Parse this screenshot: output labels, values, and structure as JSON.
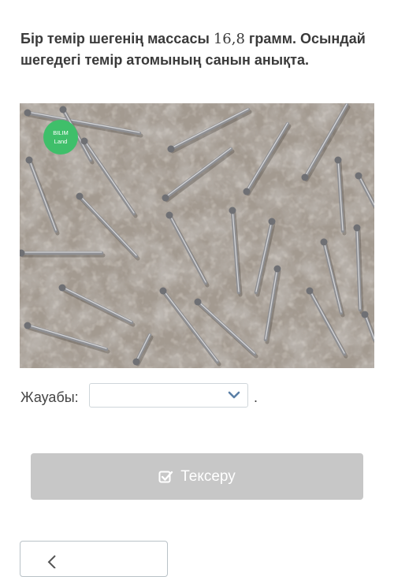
{
  "question": {
    "text_before": "Бір темір шегенің массасы ",
    "mass_value": "16,8",
    "text_after": " грамм. Осындай шегедегі темір атомының санын анықта."
  },
  "image": {
    "logo_line1": "BILIM",
    "logo_line2": "Land",
    "logo_color": "#3fbf6a"
  },
  "answer": {
    "label": "Жауабы:",
    "selected_value": "",
    "trailing": "."
  },
  "check_button": {
    "label": "Тексеру",
    "icon": "checkbox-check-icon"
  },
  "back_button": {
    "icon": "arrow-left-icon"
  },
  "colors": {
    "button_disabled": "#c7c7c7",
    "chevron": "#5b7fa6"
  }
}
